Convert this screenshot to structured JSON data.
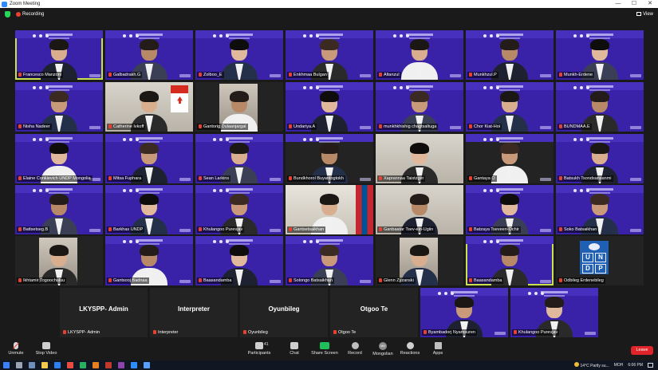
{
  "window": {
    "title": "Zoom Meeting",
    "controls": [
      "—",
      "☐",
      "✕"
    ]
  },
  "topbar": {
    "recording_label": "Recording",
    "view_label": "View"
  },
  "participants": [
    {
      "name": "Francesco Manzoni"
    },
    {
      "name": "Galbadrakh.G"
    },
    {
      "name": "Zolboo_E"
    },
    {
      "name": "Enkhmaa Bulgan"
    },
    {
      "name": "Altanzul"
    },
    {
      "name": "Munkhzul.P"
    },
    {
      "name": "Munkh-Erdene"
    },
    {
      "name": "Nisha Nadeer"
    },
    {
      "name": "Catherine Ivkoff"
    },
    {
      "name": "Gantorig Dulaanjargal"
    },
    {
      "name": "Undariya.A"
    },
    {
      "name": "munkhkhishig chagtsaltuga"
    },
    {
      "name": "Chor Kiat-Hoi"
    },
    {
      "name": "BUNDMAA.E"
    },
    {
      "name": "Elaine Conkievich UNDP Mongolia"
    },
    {
      "name": "Mitsa Fuphara"
    },
    {
      "name": "Sean Larkins"
    },
    {
      "name": "Bundkhorol Buyantogtokh"
    },
    {
      "name": "Xaprannaa Taistzger"
    },
    {
      "name": "Gantaya O"
    },
    {
      "name": "Batsukh Tsondsansanmi"
    },
    {
      "name": "Battsetseg.B"
    },
    {
      "name": "Barkhas UNDP"
    },
    {
      "name": "Khulangoo Purevjav"
    },
    {
      "name": "Gantsetsaikhan"
    },
    {
      "name": "Ganbaatar Tsev-ein-Ugiin"
    },
    {
      "name": "Batzaya Tseveen-Ochir"
    },
    {
      "name": "Soko Batsaikhan"
    },
    {
      "name": "Ikhtamir Togoochuluu"
    },
    {
      "name": "Gantsooj Badnaa"
    },
    {
      "name": "Baasandamba"
    },
    {
      "name": "Solongo Batsaikhan"
    },
    {
      "name": "Glenn Zyzanski"
    },
    {
      "name": "Baasandamba"
    },
    {
      "name": "Odbileg Erdenebileg"
    }
  ],
  "name_tiles": [
    {
      "display": "LKYSPP- Admin",
      "label": "LKYSPP- Admin"
    },
    {
      "display": "Interpreter",
      "label": "Interpreter"
    },
    {
      "display": "Oyunbileg",
      "label": "Oyunbileg"
    },
    {
      "display": "Otgoo Te",
      "label": "Otgoo Te"
    }
  ],
  "last_row": [
    {
      "name": "Byambadorj Nyamsuren"
    },
    {
      "name": "Khulangoo Purevjav"
    }
  ],
  "undp_logo": {
    "letters": [
      "U",
      "N",
      "D",
      "P"
    ]
  },
  "toolbar": {
    "unmute": "Unmute",
    "stop_video": "Stop Video",
    "participants": "Participants",
    "participants_count": "41",
    "chat": "Chat",
    "share_screen": "Share Screen",
    "record": "Record",
    "language": "Mongolian",
    "reactions": "Reactions",
    "apps": "Apps",
    "leave": "Leave",
    "language_badge": "MN"
  },
  "taskbar": {
    "weather": "14°C  Partly su...",
    "ime": "MOH",
    "time": "6:06 PM"
  },
  "colors": {
    "tile_bg": "#3a22a8",
    "active_outline": "#c9e04f",
    "leave": "#e0242a",
    "share": "#1fbf5a",
    "recording": "#e8412f"
  }
}
